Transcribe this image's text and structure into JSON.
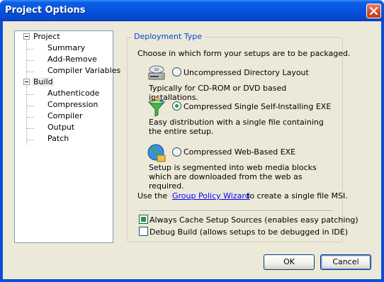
{
  "window": {
    "title": "Project Options"
  },
  "tree": {
    "items": [
      {
        "label": "Project",
        "level": 0,
        "expanded": true
      },
      {
        "label": "Summary",
        "level": 1
      },
      {
        "label": "Add-Remove",
        "level": 1
      },
      {
        "label": "Compiler Variables",
        "level": 1
      },
      {
        "label": "Build",
        "level": 0,
        "expanded": true,
        "selected": true
      },
      {
        "label": "Authenticode",
        "level": 1
      },
      {
        "label": "Compression",
        "level": 1
      },
      {
        "label": "Compiler",
        "level": 1
      },
      {
        "label": "Output",
        "level": 1
      },
      {
        "label": "Patch",
        "level": 1
      }
    ]
  },
  "deployment": {
    "legend": "Deployment Type",
    "intro": "Choose in which form your setups are to be packaged.",
    "options": [
      {
        "label": "Uncompressed Directory Layout",
        "accel": "U",
        "description": "Typically for CD-ROM or DVD based installations.",
        "checked": false,
        "icon": "cd-drive-icon"
      },
      {
        "label": "Compressed Single Self-Installing EXE",
        "accel": "o",
        "description": "Easy distribution with a single file containing the entire setup.",
        "checked": true,
        "icon": "funnel-icon"
      },
      {
        "label": "Compressed Web-Based EXE",
        "accel": "W",
        "description": "Setup is segmented into web media blocks which are downloaded from the web as required.",
        "checked": false,
        "icon": "web-globe-icon"
      }
    ],
    "gpo_prefix": "Use the",
    "gpo_link": "Group Policy Wizard",
    "gpo_suffix": "to create a single file MSI."
  },
  "options": {
    "cache_label": "Always Cache Setup Sources (enables easy patching)",
    "cache_checked": true,
    "debug_label": "Debug Build (allows setups to be debugged in IDE)",
    "debug_checked": false
  },
  "buttons": {
    "ok": "OK",
    "cancel": "Cancel"
  }
}
